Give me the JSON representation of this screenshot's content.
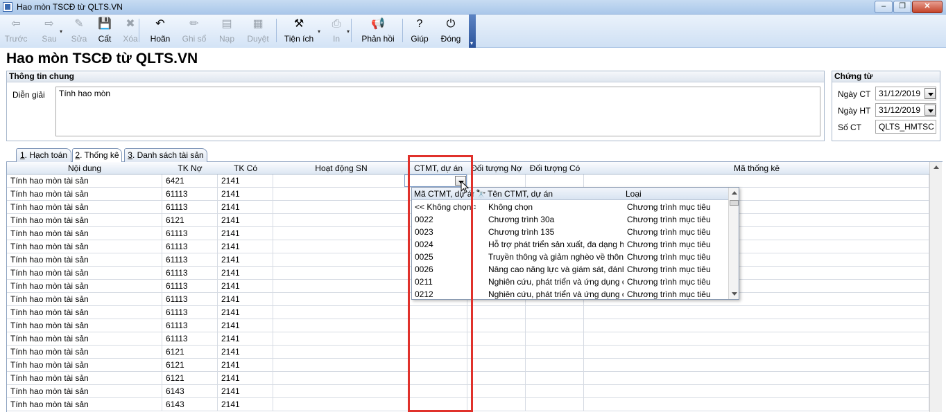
{
  "window": {
    "title": "Hao mòn TSCĐ từ QLTS.VN",
    "buttons": {
      "minimize": "–",
      "restore": "❐",
      "close": "✕"
    }
  },
  "toolbar": {
    "items": [
      {
        "label": "Trước",
        "icon": "arrow-left-icon",
        "glyph": "⇦",
        "enabled": false
      },
      {
        "label": "Sau",
        "icon": "arrow-right-icon",
        "glyph": "⇨",
        "enabled": false
      },
      {
        "label": "Sửa",
        "icon": "edit-icon",
        "glyph": "✎",
        "enabled": false
      },
      {
        "label": "Cất",
        "icon": "save-icon",
        "glyph": "💾",
        "enabled": true
      },
      {
        "label": "Xóa",
        "icon": "delete-icon",
        "glyph": "✖",
        "enabled": false
      },
      {
        "label": "Hoãn",
        "icon": "undo-icon",
        "glyph": "↶",
        "enabled": true
      },
      {
        "label": "Ghi sổ",
        "icon": "pencil-icon",
        "glyph": "✏",
        "enabled": false
      },
      {
        "label": "Nạp",
        "icon": "load-icon",
        "glyph": "▤",
        "enabled": false
      },
      {
        "label": "Duyệt",
        "icon": "approve-icon",
        "glyph": "▦",
        "enabled": false
      },
      {
        "label": "Tiện ích",
        "icon": "tools-icon",
        "glyph": "⚒",
        "enabled": true
      },
      {
        "label": "In",
        "icon": "print-icon",
        "glyph": "⎙",
        "enabled": false
      },
      {
        "label": "Phản hồi",
        "icon": "megaphone-icon",
        "glyph": "📢",
        "enabled": true
      },
      {
        "label": "Giúp",
        "icon": "help-icon",
        "glyph": "?",
        "enabled": true
      },
      {
        "label": "Đóng",
        "icon": "power-icon",
        "glyph": "⏻",
        "enabled": true
      }
    ]
  },
  "page_title": "Hao mòn TSCĐ từ QLTS.VN",
  "general": {
    "header": "Thông tin chung",
    "description_label": "Diễn giải",
    "description_value": "Tính hao mòn"
  },
  "voucher": {
    "header": "Chứng từ",
    "date_ct_label": "Ngày CT",
    "date_ct_value": "31/12/2019",
    "date_ht_label": "Ngày HT",
    "date_ht_value": "31/12/2019",
    "number_label": "Số CT",
    "number_value": "QLTS_HMTSC"
  },
  "tabs": [
    {
      "num": "1",
      "label": ". Hạch toán"
    },
    {
      "num": "2",
      "label": ". Thống kê"
    },
    {
      "num": "3",
      "label": ". Danh sách tài sản"
    }
  ],
  "grid": {
    "columns": [
      "Nội dung",
      "TK Nợ",
      "TK Có",
      "Hoạt động SN",
      "CTMT, dự án",
      "Đối tượng Nợ",
      "Đối tượng Có",
      "Mã thống kê"
    ],
    "rows": [
      [
        "Tính hao mòn tài sản",
        "6421",
        "2141"
      ],
      [
        "Tính hao mòn tài sản",
        "61113",
        "2141"
      ],
      [
        "Tính hao mòn tài sản",
        "61113",
        "2141"
      ],
      [
        "Tính hao mòn tài sản",
        "6121",
        "2141"
      ],
      [
        "Tính hao mòn tài sản",
        "61113",
        "2141"
      ],
      [
        "Tính hao mòn tài sản",
        "61113",
        "2141"
      ],
      [
        "Tính hao mòn tài sản",
        "61113",
        "2141"
      ],
      [
        "Tính hao mòn tài sản",
        "61113",
        "2141"
      ],
      [
        "Tính hao mòn tài sản",
        "61113",
        "2141"
      ],
      [
        "Tính hao mòn tài sản",
        "61113",
        "2141"
      ],
      [
        "Tính hao mòn tài sản",
        "61113",
        "2141"
      ],
      [
        "Tính hao mòn tài sản",
        "61113",
        "2141"
      ],
      [
        "Tính hao mòn tài sản",
        "61113",
        "2141"
      ],
      [
        "Tính hao mòn tài sản",
        "6121",
        "2141"
      ],
      [
        "Tính hao mòn tài sản",
        "6121",
        "2141"
      ],
      [
        "Tính hao mòn tài sản",
        "6121",
        "2141"
      ],
      [
        "Tính hao mòn tài sản",
        "6143",
        "2141"
      ],
      [
        "Tính hao mòn tài sản",
        "6143",
        "2141"
      ]
    ]
  },
  "dropdown": {
    "columns": [
      "Mã CTMT, dự án",
      "Tên CTMT, dự án",
      "Loại"
    ],
    "rows": [
      [
        "<< Không chọn >>",
        "Không chọn",
        "Chương trình mục tiêu"
      ],
      [
        "0022",
        "Chương trình 30a",
        "Chương trình mục tiêu"
      ],
      [
        "0023",
        "Chương trình 135",
        "Chương trình mục tiêu"
      ],
      [
        "0024",
        "Hỗ trợ phát triển sản xuất, đa dạng h...",
        "Chương trình mục tiêu"
      ],
      [
        "0025",
        "Truyền thông và giảm nghèo về thôn...",
        "Chương trình mục tiêu"
      ],
      [
        "0026",
        "Nâng cao năng lực và giám sát, đánh...",
        "Chương trình mục tiêu"
      ],
      [
        "0211",
        "Nghiên cứu, phát triển và ứng dụng c...",
        "Chương trình mục tiêu"
      ],
      [
        "0212",
        "Nghiên cứu, phát triển và ứng dụng c...",
        "Chương trình mục tiêu"
      ]
    ]
  },
  "colors": {
    "highlight": "#e0312b",
    "toolbar_end": "#2b539b"
  }
}
